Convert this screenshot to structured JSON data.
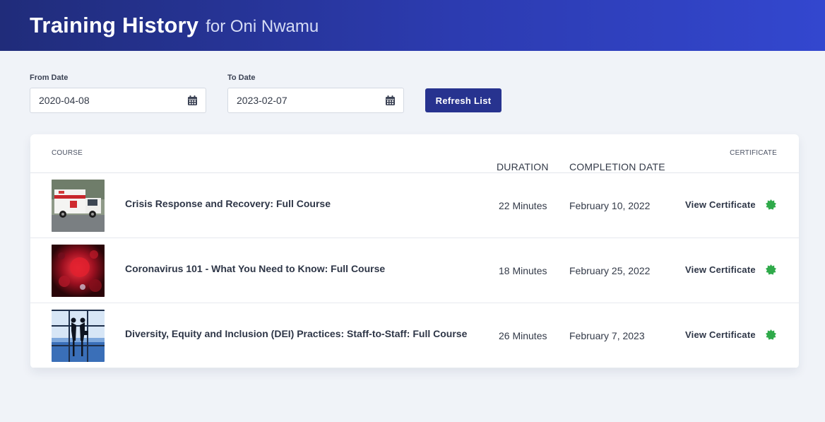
{
  "header": {
    "title": "Training History",
    "subtitle": "for Oni Nwamu"
  },
  "filters": {
    "from_label": "From Date",
    "from_value": "2020-04-08",
    "to_label": "To Date",
    "to_value": "2023-02-07",
    "refresh_label": "Refresh List"
  },
  "table": {
    "columns": {
      "course": "COURSE",
      "duration": "DURATION",
      "completion": "COMPLETION DATE",
      "certificate": "CERTIFICATE"
    },
    "rows": [
      {
        "course": "Crisis Response and Recovery: Full Course",
        "duration": "22 Minutes",
        "completion": "February 10, 2022",
        "certificate": "View Certificate"
      },
      {
        "course": "Coronavirus 101 - What You Need to Know: Full Course",
        "duration": "18 Minutes",
        "completion": "February 25, 2022",
        "certificate": "View Certificate"
      },
      {
        "course": "Diversity, Equity and Inclusion (DEI) Practices: Staff-to-Staff: Full Course",
        "duration": "26 Minutes",
        "completion": "February 7, 2023",
        "certificate": "View Certificate"
      }
    ]
  },
  "colors": {
    "header_start": "#202c7a",
    "header_end": "#3347cf",
    "button": "#27338f",
    "badge": "#2faa4a",
    "background": "#f0f3f8"
  },
  "icons": {
    "date_picker": "calendar-icon",
    "certificate_status": "verified-badge-icon"
  }
}
